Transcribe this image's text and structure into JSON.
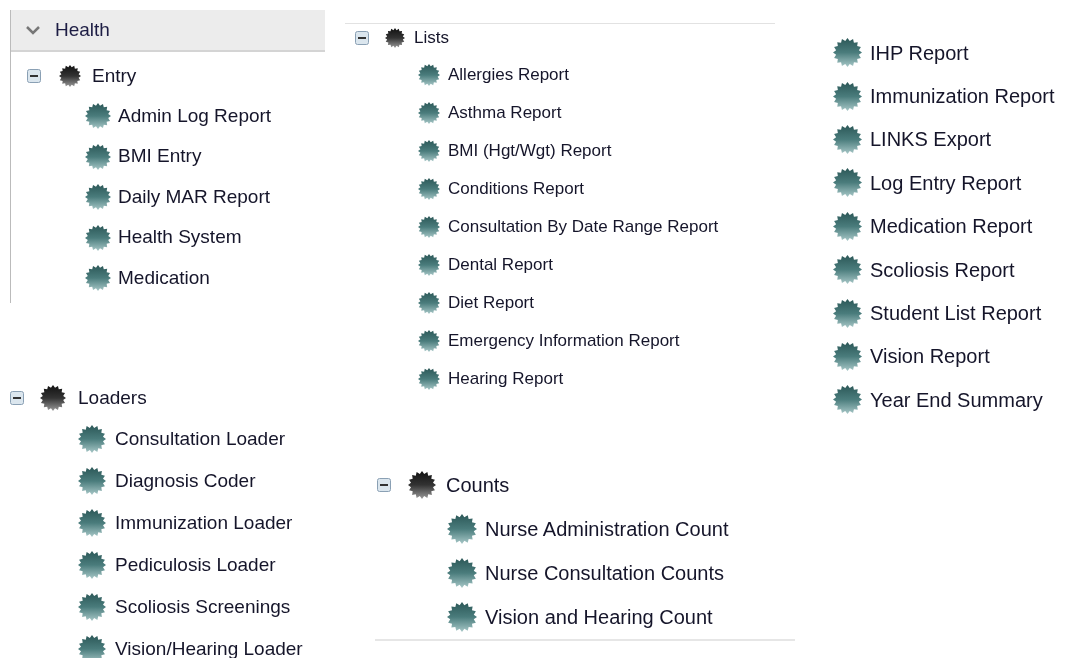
{
  "panels": [
    {
      "kind": "accordion",
      "header": {
        "label": "Health",
        "expanded": true
      },
      "tree": [
        {
          "label": "Entry",
          "expanded": true,
          "children": [
            {
              "label": "Admin Log Report"
            },
            {
              "label": "BMI Entry"
            },
            {
              "label": "Daily MAR Report"
            },
            {
              "label": "Health System"
            },
            {
              "label": "Medication"
            }
          ]
        }
      ]
    },
    {
      "kind": "tree",
      "tree": [
        {
          "label": "Lists",
          "expanded": true,
          "children": [
            {
              "label": "Allergies Report"
            },
            {
              "label": "Asthma Report"
            },
            {
              "label": "BMI (Hgt/Wgt) Report"
            },
            {
              "label": "Conditions Report"
            },
            {
              "label": "Consultation By Date Range Report"
            },
            {
              "label": "Dental Report"
            },
            {
              "label": "Diet Report"
            },
            {
              "label": "Emergency Information Report"
            },
            {
              "label": "Hearing Report"
            }
          ]
        }
      ]
    },
    {
      "kind": "list",
      "items": [
        {
          "label": "IHP Report"
        },
        {
          "label": "Immunization Report"
        },
        {
          "label": "LINKS Export"
        },
        {
          "label": "Log Entry Report"
        },
        {
          "label": "Medication Report"
        },
        {
          "label": "Scoliosis Report"
        },
        {
          "label": "Student List Report"
        },
        {
          "label": "Vision Report"
        },
        {
          "label": "Year End Summary"
        }
      ]
    },
    {
      "kind": "tree",
      "tree": [
        {
          "label": "Loaders",
          "expanded": true,
          "children": [
            {
              "label": "Consultation Loader"
            },
            {
              "label": "Diagnosis Coder"
            },
            {
              "label": "Immunization Loader"
            },
            {
              "label": "Pediculosis Loader"
            },
            {
              "label": "Scoliosis Screenings"
            },
            {
              "label": "Vision/Hearing Loader"
            }
          ]
        }
      ]
    },
    {
      "kind": "tree",
      "tree": [
        {
          "label": "Counts",
          "expanded": true,
          "children": [
            {
              "label": "Nurse Administration Count"
            },
            {
              "label": "Nurse Consultation Counts"
            },
            {
              "label": "Vision and Hearing Count"
            }
          ]
        }
      ]
    }
  ]
}
